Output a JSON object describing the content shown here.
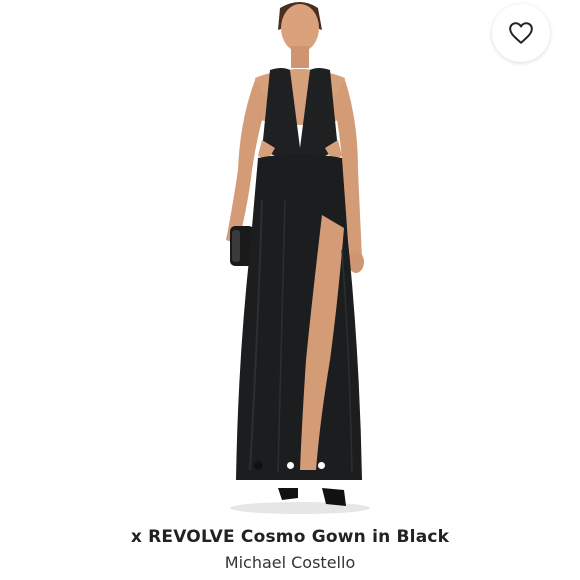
{
  "listing": {
    "title": "x REVOLVE Cosmo Gown in Black",
    "brand": "Michael Costello"
  },
  "favorite_button": {
    "icon": "heart-outline-icon"
  },
  "gallery": {
    "image_count": 3,
    "active_index": 0
  },
  "colors": {
    "gown": "#1b1d1f",
    "skin": "#d8a27c",
    "background": "#ffffff",
    "text": "#222222"
  }
}
